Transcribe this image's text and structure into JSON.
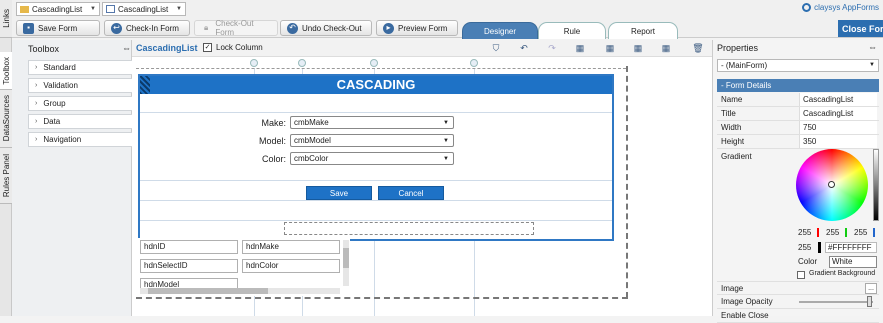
{
  "rail": {
    "links": "Links",
    "toolbox": "Toolbox",
    "datasources": "DataSources",
    "rules_panel": "Rules Panel"
  },
  "topbar": {
    "dropdown1": "CascadingList",
    "dropdown2": "CascadingList",
    "brand": "claysys AppForms"
  },
  "toolbar": {
    "save": "Save Form",
    "checkin": "Check-In Form",
    "checkout": "Check-Out Form",
    "undo_checkout": "Undo Check-Out",
    "preview": "Preview Form"
  },
  "tabs": {
    "designer": "Designer",
    "rule": "Rule",
    "report": "Report"
  },
  "close_form": "Close Form",
  "toolbox": {
    "title": "Toolbox",
    "items": [
      "Standard",
      "Validation",
      "Group",
      "Data",
      "Navigation"
    ]
  },
  "designer": {
    "form_name": "CascadingList",
    "lock_label": "Lock Column",
    "header": "CASCADING",
    "fields": [
      {
        "label": "Make:",
        "value": "cmbMake"
      },
      {
        "label": "Model:",
        "value": "cmbModel"
      },
      {
        "label": "Color:",
        "value": "cmbColor"
      }
    ],
    "save_button": "Save",
    "cancel_button": "Cancel",
    "hidden_fields": [
      "hdnID",
      "hdnMake",
      "hdnSelectID",
      "hdnColor",
      "hdnModel"
    ]
  },
  "properties": {
    "title": "Properties",
    "selected": "- (MainForm)",
    "section": "Form Details",
    "rows": [
      {
        "key": "Name",
        "value": "CascadingList"
      },
      {
        "key": "Title",
        "value": "CascadingList"
      },
      {
        "key": "Width",
        "value": "750"
      },
      {
        "key": "Height",
        "value": "350"
      }
    ],
    "gradient_label": "Gradient",
    "rgb": {
      "r": "255",
      "g": "255",
      "b": "255"
    },
    "alpha": "255",
    "hex": "#FFFFFFFF",
    "color_label": "Color",
    "color_value": "White",
    "gradient_bg": "Gradient Background",
    "image_label": "Image",
    "image_opacity_label": "Image Opacity",
    "enable_close_label": "Enable Close"
  },
  "colors": {
    "accent": "#1e72c6",
    "tab_active": "#4a7fb5"
  }
}
